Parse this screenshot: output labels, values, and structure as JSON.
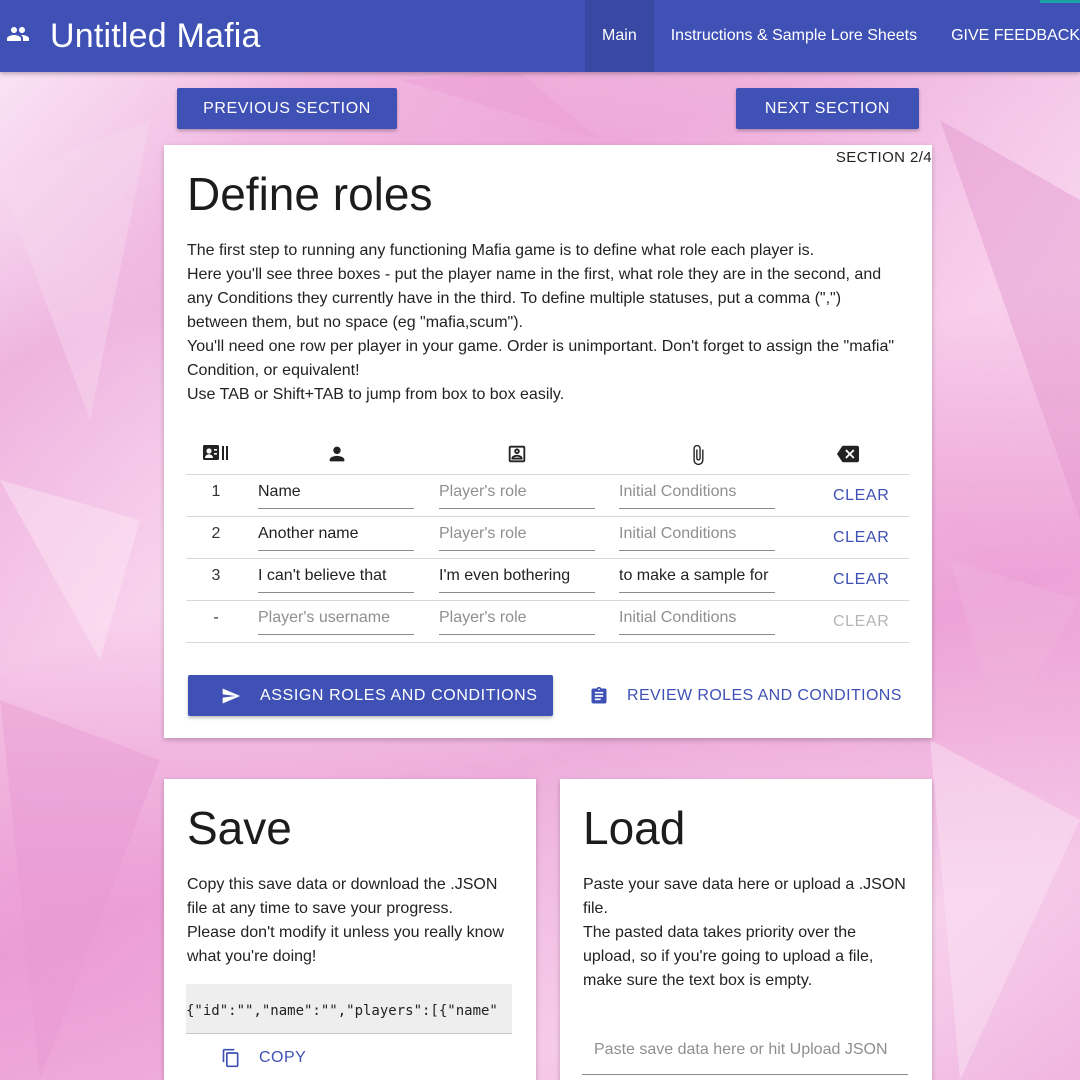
{
  "app": {
    "title": "Untitled Mafia",
    "logo_icon": "people-icon"
  },
  "nav": {
    "items": [
      {
        "label": "Main",
        "active": true
      },
      {
        "label": "Instructions & Sample Lore Sheets",
        "active": false
      },
      {
        "label": "GIVE FEEDBACK",
        "active": false
      }
    ]
  },
  "section_nav": {
    "previous": "PREVIOUS SECTION",
    "next": "NEXT SECTION"
  },
  "roles_card": {
    "section_label": "SECTION 2/4",
    "title": "Define roles",
    "paragraph_lines": [
      "The first step to running any functioning Mafia game is to define what role each player is.",
      "Here you'll see three boxes - put the player name in the first, what role they are in the second, and",
      "any Conditions they currently have in the third. To define multiple statuses, put a comma (\",\")",
      "between them, but no space (eg \"mafia,scum\").",
      "You'll need one row per player in your game. Order is unimportant. Don't forget to assign the \"mafia\"",
      "Condition, or equivalent!",
      "Use TAB or Shift+TAB to jump from box to box easily."
    ],
    "column_icons": [
      "id-badge-icon",
      "person-icon",
      "account-box-icon",
      "attachment-icon",
      "backspace-icon"
    ],
    "rows": [
      {
        "num": "1",
        "name": "Name",
        "name_is_placeholder": false,
        "role": "Player's role",
        "role_is_placeholder": true,
        "conditions": "Initial Conditions",
        "conditions_is_placeholder": true,
        "clear": "CLEAR",
        "clear_enabled": true
      },
      {
        "num": "2",
        "name": "Another name",
        "name_is_placeholder": false,
        "role": "Player's role",
        "role_is_placeholder": true,
        "conditions": "Initial Conditions",
        "conditions_is_placeholder": true,
        "clear": "CLEAR",
        "clear_enabled": true
      },
      {
        "num": "3",
        "name": "I can't believe that",
        "name_is_placeholder": false,
        "role": "I'm even bothering",
        "role_is_placeholder": false,
        "conditions": "to make a sample for",
        "conditions_is_placeholder": false,
        "clear": "CLEAR",
        "clear_enabled": true
      },
      {
        "num": "-",
        "name": "Player's username",
        "name_is_placeholder": true,
        "role": "Player's role",
        "role_is_placeholder": true,
        "conditions": "Initial Conditions",
        "conditions_is_placeholder": true,
        "clear": "CLEAR",
        "clear_enabled": false
      }
    ],
    "assign_button": "ASSIGN ROLES AND CONDITIONS",
    "review_button": "REVIEW ROLES AND CONDITIONS"
  },
  "save_card": {
    "title": "Save",
    "paragraph_lines": [
      "Copy this save data or download the .JSON",
      "file at any time to save your progress.",
      "Please don't modify it unless you really know",
      "what you're doing!"
    ],
    "save_data": "{\"id\":\"\",\"name\":\"\",\"players\":[{\"name\"",
    "copy_button": "COPY"
  },
  "load_card": {
    "title": "Load",
    "paragraph_lines": [
      "Paste your save data here or upload a .JSON",
      "file.",
      "The pasted data takes priority over the",
      "upload, so if you're going to upload a file,",
      "make sure the text box is empty."
    ],
    "input_placeholder": "Paste save data here or hit Upload JSON"
  },
  "colors": {
    "primary": "#3f51b5",
    "nav_active": "#3949a3",
    "background_pink": "#f3c6e6"
  }
}
